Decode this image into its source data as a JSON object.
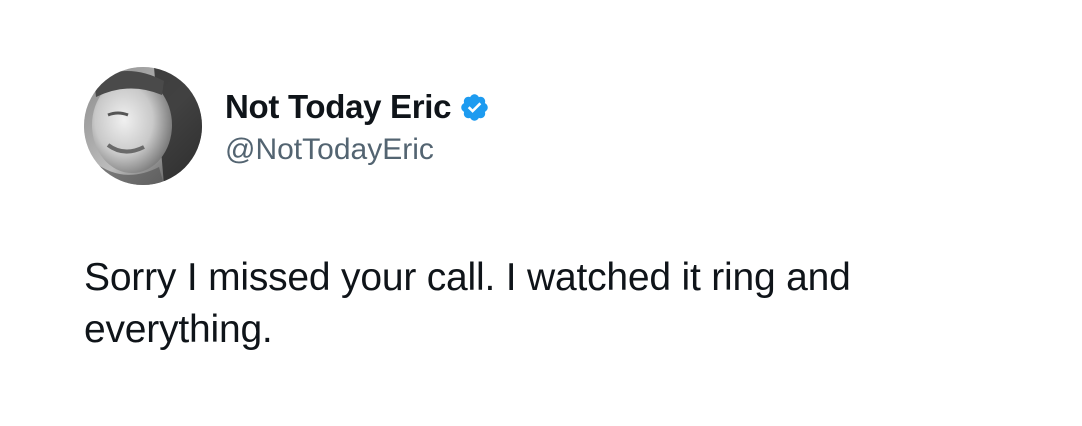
{
  "tweet": {
    "author": {
      "display_name": "Not Today Eric",
      "handle": "@NotTodayEric",
      "verified": true,
      "verified_badge_color": "#1d9bf0",
      "avatar_icon": "user-avatar-photo"
    },
    "text": "Sorry I missed your call. I watched it ring and everything."
  },
  "colors": {
    "background": "#ffffff",
    "text_primary": "#0f1419",
    "text_secondary": "#536471"
  }
}
